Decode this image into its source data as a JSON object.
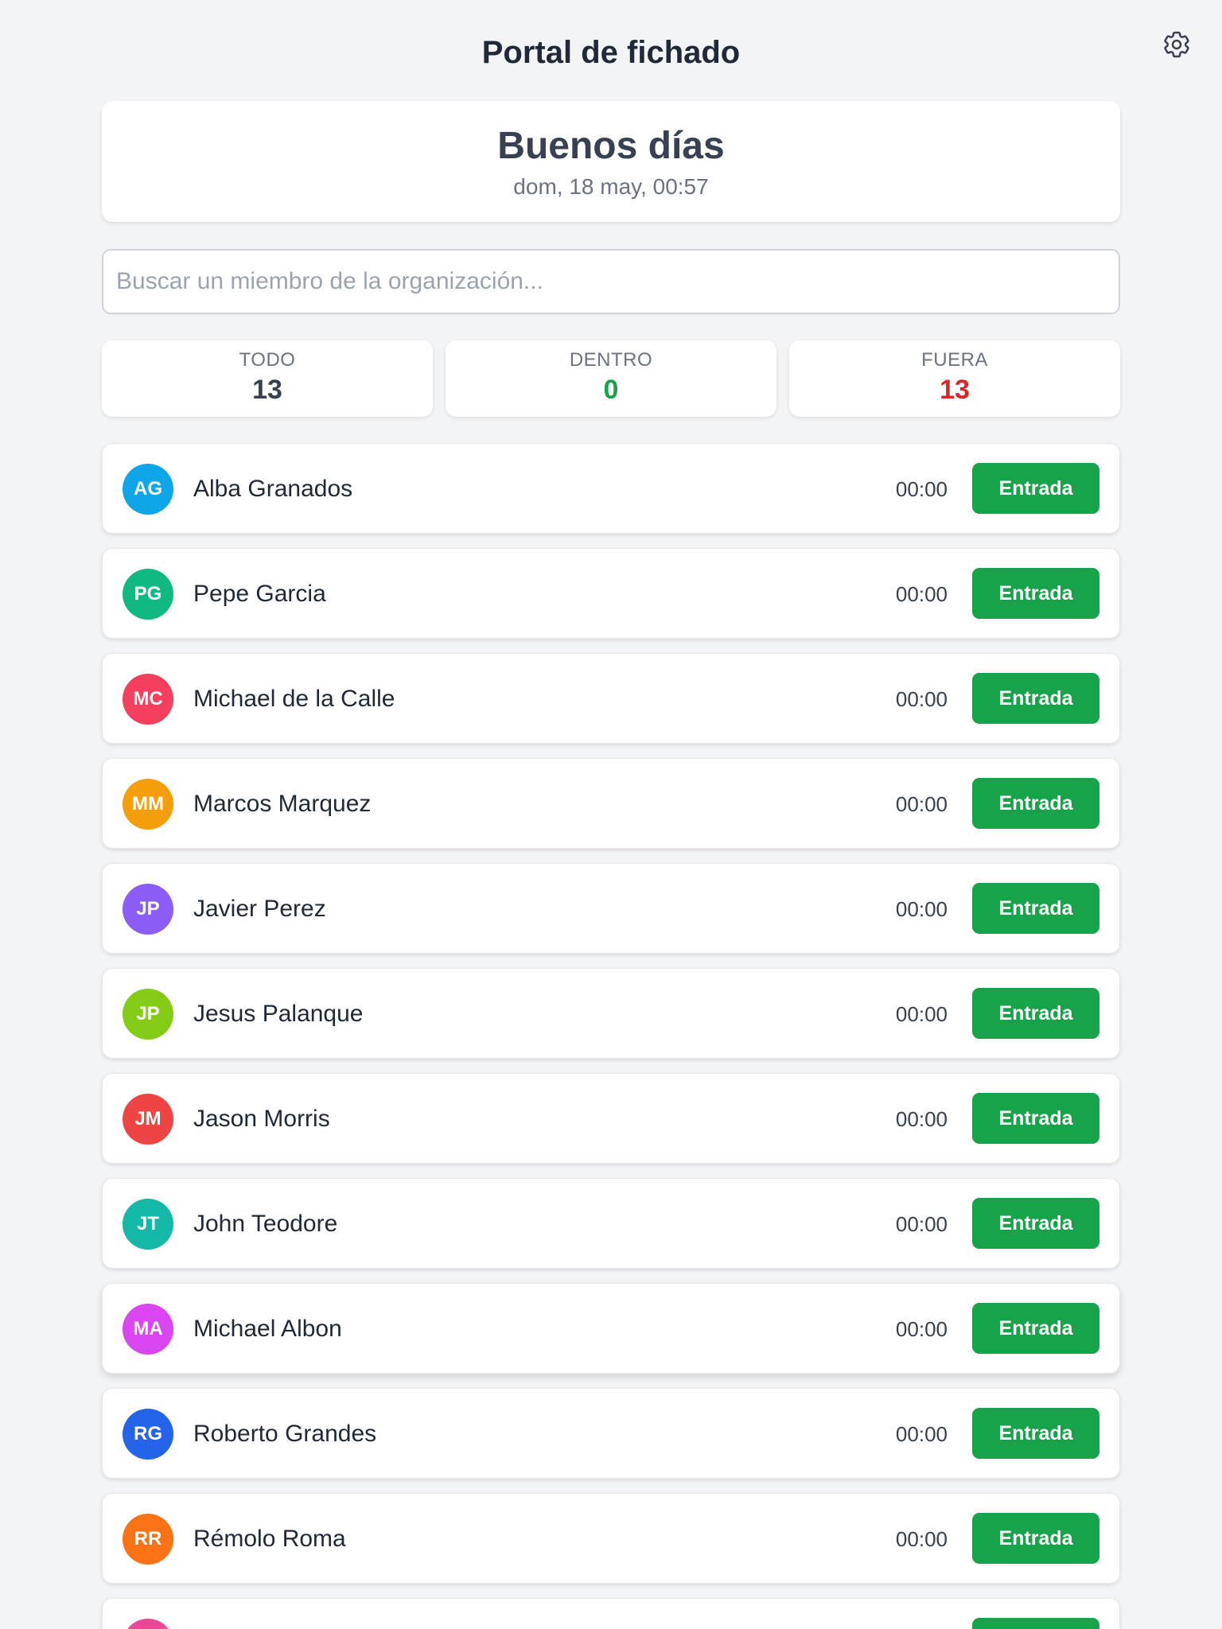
{
  "header": {
    "title": "Portal de fichado",
    "settings_icon": "gear-icon"
  },
  "greeting": {
    "title": "Buenos días",
    "date": "dom, 18 may, 00:57"
  },
  "search": {
    "placeholder": "Buscar un miembro de la organización..."
  },
  "stats": [
    {
      "label": "TODO",
      "value": "13",
      "color": "#374151"
    },
    {
      "label": "DENTRO",
      "value": "0",
      "color": "#16a34a"
    },
    {
      "label": "FUERA",
      "value": "13",
      "color": "#dc2626"
    }
  ],
  "members": [
    {
      "initials": "AG",
      "name": "Alba Granados",
      "time": "00:00",
      "action": "Entrada",
      "color": "#0ea5e9"
    },
    {
      "initials": "PG",
      "name": "Pepe Garcia",
      "time": "00:00",
      "action": "Entrada",
      "color": "#10b981"
    },
    {
      "initials": "MC",
      "name": "Michael de la Calle",
      "time": "00:00",
      "action": "Entrada",
      "color": "#f43f5e"
    },
    {
      "initials": "MM",
      "name": "Marcos Marquez",
      "time": "00:00",
      "action": "Entrada",
      "color": "#f59e0b"
    },
    {
      "initials": "JP",
      "name": "Javier Perez",
      "time": "00:00",
      "action": "Entrada",
      "color": "#8b5cf6"
    },
    {
      "initials": "JP",
      "name": "Jesus Palanque",
      "time": "00:00",
      "action": "Entrada",
      "color": "#84cc16"
    },
    {
      "initials": "JM",
      "name": "Jason Morris",
      "time": "00:00",
      "action": "Entrada",
      "color": "#ef4444"
    },
    {
      "initials": "JT",
      "name": "John Teodore",
      "time": "00:00",
      "action": "Entrada",
      "color": "#14b8a6"
    },
    {
      "initials": "MA",
      "name": "Michael Albon",
      "time": "00:00",
      "action": "Entrada",
      "color": "#d946ef"
    },
    {
      "initials": "RG",
      "name": "Roberto Grandes",
      "time": "00:00",
      "action": "Entrada",
      "color": "#2563eb"
    },
    {
      "initials": "RR",
      "name": "Rémolo Roma",
      "time": "00:00",
      "action": "Entrada",
      "color": "#f97316"
    },
    {
      "initials": "",
      "name": "",
      "time": "",
      "action": "",
      "color": "#ec4899"
    }
  ]
}
